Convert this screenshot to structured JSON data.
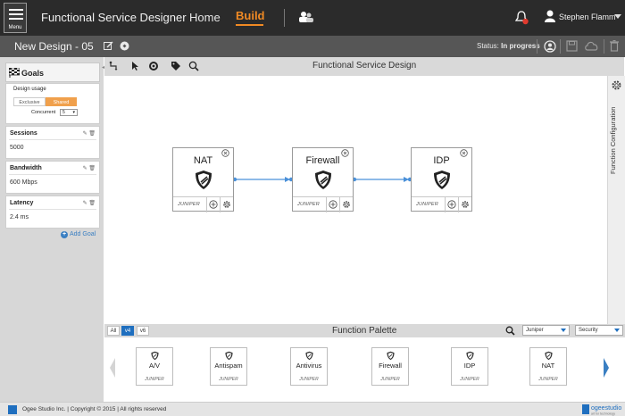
{
  "header": {
    "menu_label": "Menu",
    "app_title": "Functional Service Designer",
    "nav_home": "Home",
    "nav_build": "Build",
    "user_name": "Stephen Flamm",
    "accent": "#f08a24"
  },
  "subheader": {
    "design_name": "New Design - 05",
    "status_label": "Status:",
    "status_value": "In progress"
  },
  "goals": {
    "title": "Goals",
    "usage": {
      "label": "Design usage",
      "exclusive": "Exclusive",
      "shared": "Shared",
      "concurrent_label": "Concurrent",
      "concurrent_value": "5"
    },
    "items": [
      {
        "name": "Sessions",
        "value": "5000"
      },
      {
        "name": "Bandwidth",
        "value": "600 Mbps"
      },
      {
        "name": "Latency",
        "value": "2.4 ms"
      }
    ],
    "add_label": "Add Goal"
  },
  "canvas": {
    "title": "Functional Service Design",
    "config_label": "Function Configuration",
    "functions": [
      {
        "name": "NAT",
        "brand": "JUNIPER"
      },
      {
        "name": "Firewall",
        "brand": "JUNIPER"
      },
      {
        "name": "IDP",
        "brand": "JUNIPER"
      }
    ]
  },
  "palette": {
    "title": "Function Palette",
    "versions": [
      "All",
      "v4",
      "v6"
    ],
    "active_version": "v4",
    "vendor_filter": "Juniper",
    "category_filter": "Security",
    "items": [
      {
        "name": "A/V",
        "brand": "JUNIPER"
      },
      {
        "name": "Antispam",
        "brand": "JUNIPER"
      },
      {
        "name": "Antivirus",
        "brand": "JUNIPER"
      },
      {
        "name": "Firewall",
        "brand": "JUNIPER"
      },
      {
        "name": "IDP",
        "brand": "JUNIPER"
      },
      {
        "name": "NAT",
        "brand": "JUNIPER"
      }
    ]
  },
  "footer": {
    "text": "Ogee Studio Inc. | Copyright © 2015 | All rights reserved",
    "brand": "ogeestudio",
    "brand_tagline": "art for technology"
  }
}
